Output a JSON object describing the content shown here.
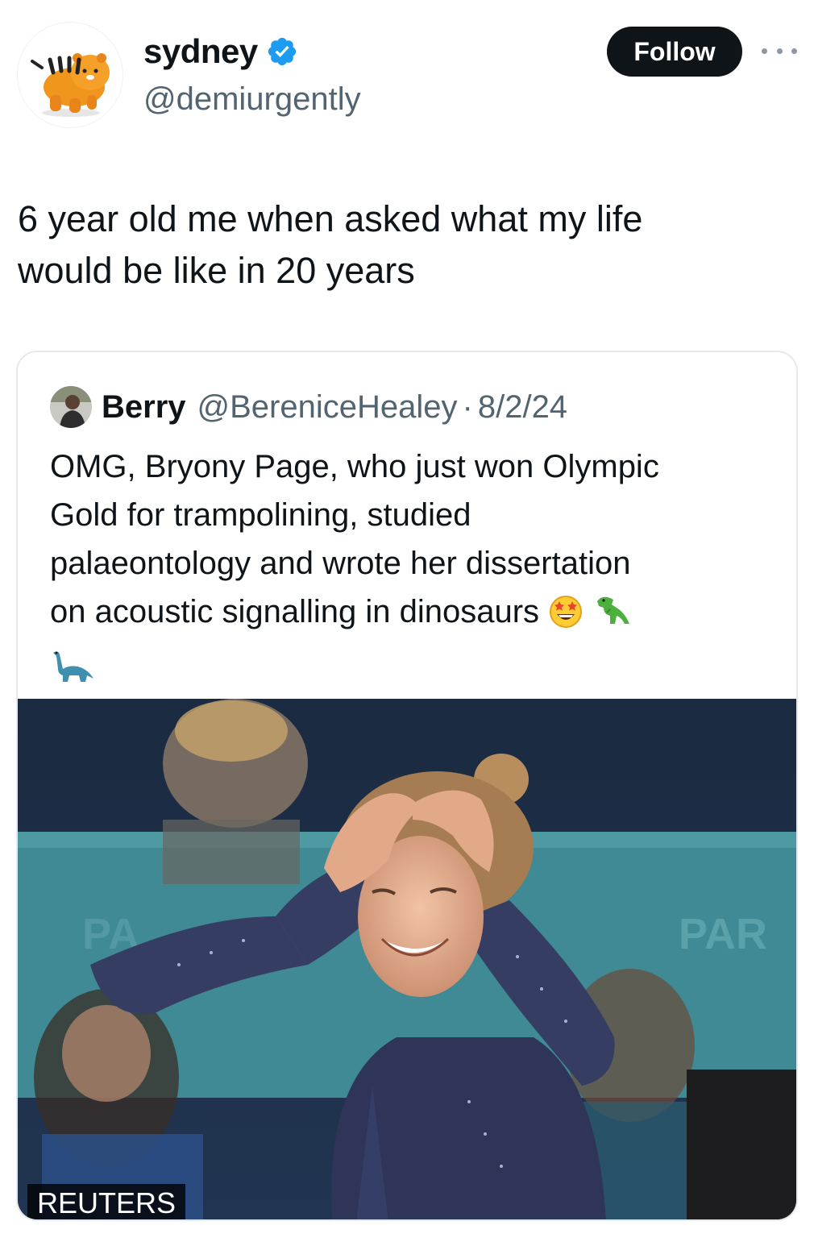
{
  "author": {
    "display_name": "sydney",
    "handle": "@demiurgently",
    "verified": true,
    "avatar_icon": "orange-tiger-plush-avatar"
  },
  "follow_label": "Follow",
  "more_icon": "ellipsis-icon",
  "tweet": {
    "lines": [
      "6 year old me when asked what my life",
      "would be like in 20 years"
    ]
  },
  "quoted": {
    "name": "Berry",
    "handle": "@BereniceHealey",
    "separator": "·",
    "date": "8/2/24",
    "lines": [
      "OMG, Bryony Page, who just won Olympic",
      "Gold for trampolining, studied",
      "palaeontology and wrote her dissertation",
      "on acoustic signalling in dinosaurs"
    ],
    "emojis": [
      "star-struck-emoji",
      "t-rex-emoji",
      "sauropod-emoji"
    ],
    "photo_credit": "REUTERS",
    "photo_icon": "gymnast-celebrating-photo"
  },
  "colors": {
    "verified_blue": "#1d9bf0",
    "follow_bg": "#0f1419",
    "secondary_text": "#536471"
  }
}
